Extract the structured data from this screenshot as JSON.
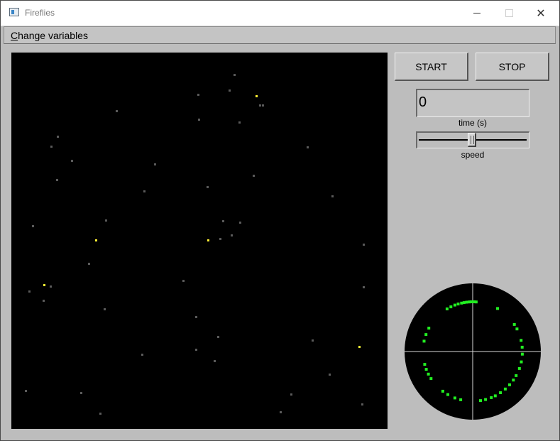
{
  "window": {
    "title": "Fireflies",
    "minimize_icon": "minimize-icon",
    "maximize_icon": "maximize-icon",
    "close_icon": "close-icon",
    "close_glyph": "✕"
  },
  "menu": {
    "items": [
      {
        "label": "Change variables"
      }
    ]
  },
  "controls": {
    "start_label": "START",
    "stop_label": "STOP",
    "time_value": "0",
    "time_label": "time (s)",
    "speed_label": "speed",
    "speed_value": 0.48
  },
  "colors": {
    "background": "#bdbdbd",
    "canvas": "#000000",
    "firefly_dim": "#5a5a5a",
    "firefly_lit": "#ffee33",
    "phase_dot": "#22ee22",
    "axis": "#d8d8d8"
  },
  "fireflies": {
    "lit_count": 5,
    "dim_count": 55
  }
}
